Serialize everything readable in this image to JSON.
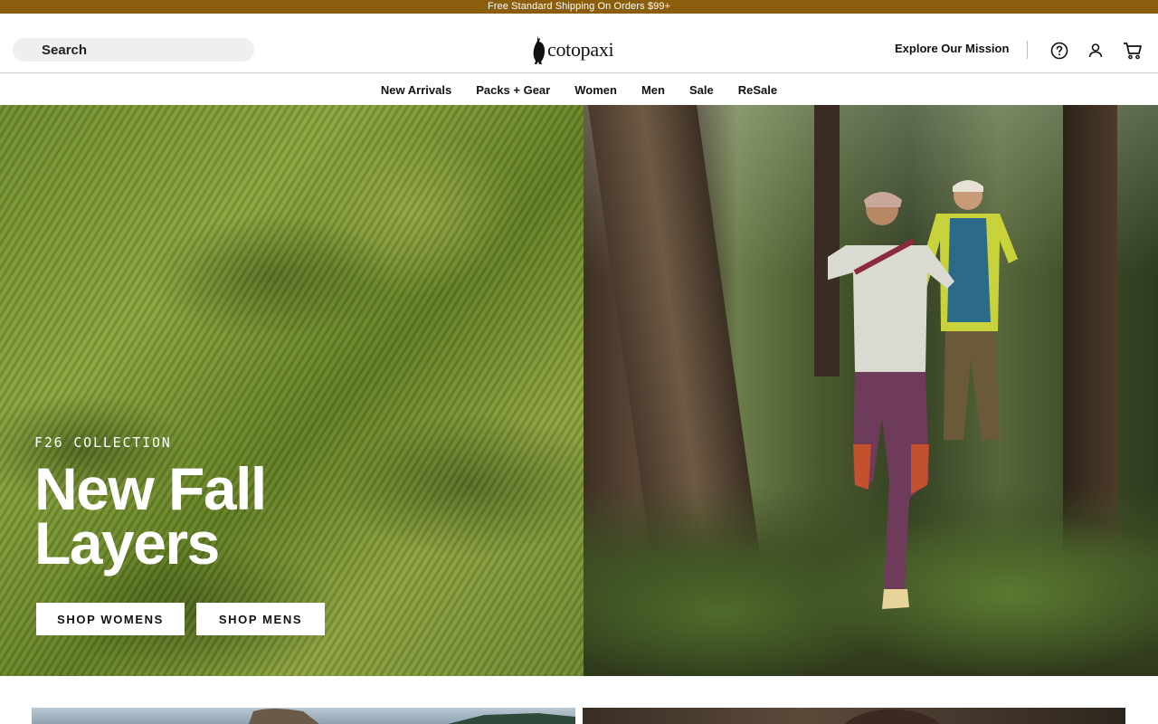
{
  "promo": {
    "text": "Free Standard Shipping On Orders $99+"
  },
  "header": {
    "search_label": "Search",
    "logo_text": "cotopaxi",
    "mission_link": "Explore Our Mission",
    "icons": [
      "help-icon",
      "account-icon",
      "cart-icon"
    ]
  },
  "nav": {
    "items": [
      {
        "label": "New Arrivals"
      },
      {
        "label": "Packs + Gear"
      },
      {
        "label": "Women"
      },
      {
        "label": "Men"
      },
      {
        "label": "Sale"
      },
      {
        "label": "ReSale"
      }
    ]
  },
  "hero": {
    "eyebrow": "F26 COLLECTION",
    "headline_line1": "New Fall",
    "headline_line2": "Layers",
    "cta_women": "SHOP WOMENS",
    "cta_men": "SHOP MENS"
  },
  "colors": {
    "promo_bar": "#8a5e0c",
    "cta_bg": "#ffffff",
    "hero_green": "#7b973a"
  }
}
